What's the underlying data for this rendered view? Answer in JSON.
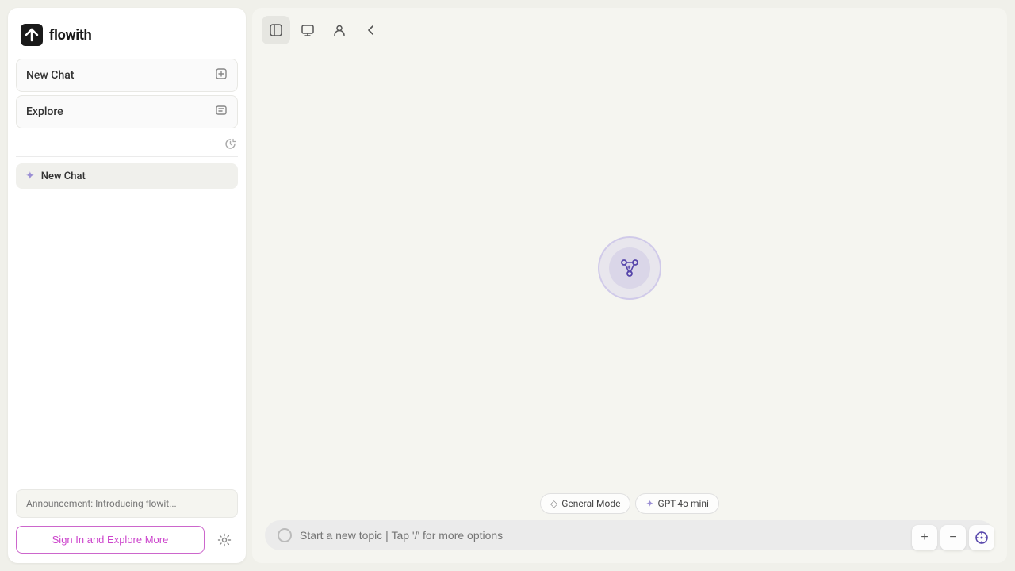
{
  "app": {
    "logo_text": "flowith",
    "logo_icon": "⬛"
  },
  "sidebar": {
    "nav_items": [
      {
        "id": "new-chat",
        "label": "New Chat",
        "icon": "✏️"
      },
      {
        "id": "explore",
        "label": "Explore",
        "icon": "🗂️"
      }
    ],
    "history_tooltip": "History",
    "active_chat": {
      "icon": "✦",
      "label": "New Chat"
    },
    "announcement": "Announcement: Introducing flowit...",
    "sign_in_label": "Sign In and Explore More",
    "settings_icon": "⚙️"
  },
  "toolbar": {
    "buttons": [
      {
        "id": "sidebar-toggle",
        "icon": "▣",
        "tooltip": "Toggle Sidebar"
      },
      {
        "id": "screen",
        "icon": "⬜",
        "tooltip": "Screen"
      },
      {
        "id": "person",
        "icon": "👤",
        "tooltip": "Person"
      },
      {
        "id": "collapse",
        "icon": "‹",
        "tooltip": "Collapse"
      }
    ]
  },
  "main": {
    "workflow_icon": "⚙",
    "mode_pills": [
      {
        "id": "general-mode",
        "icon": "◇",
        "label": "General Mode"
      },
      {
        "id": "gpt-4o-mini",
        "icon": "✦",
        "label": "GPT-4o mini"
      }
    ],
    "chat_placeholder": "Start a new topic | Tap '/' for more options"
  },
  "controls": {
    "zoom_in": "+",
    "zoom_out": "−",
    "compass": "◎"
  }
}
